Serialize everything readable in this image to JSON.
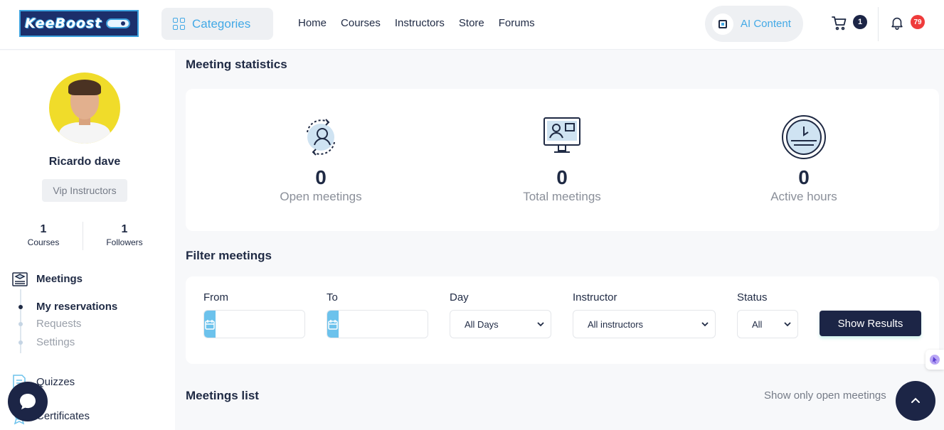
{
  "header": {
    "logo_text": "KeeBoost",
    "categories_label": "Categories",
    "nav": [
      "Home",
      "Courses",
      "Instructors",
      "Store",
      "Forums"
    ],
    "ai_label": "AI Content",
    "cart_count": "1",
    "notif_count": "79"
  },
  "sidebar": {
    "user_name": "Ricardo dave",
    "role": "Vip Instructors",
    "stats": [
      {
        "value": "1",
        "label": "Courses"
      },
      {
        "value": "1",
        "label": "Followers"
      }
    ],
    "menu_title": "Meetings",
    "submenu": [
      "My reservations",
      "Requests",
      "Settings"
    ],
    "items": [
      "Quizzes",
      "Certificates"
    ]
  },
  "main": {
    "stats_title": "Meeting statistics",
    "stats": [
      {
        "value": "0",
        "label": "Open meetings",
        "icon": "open-meetings-icon"
      },
      {
        "value": "0",
        "label": "Total meetings",
        "icon": "total-meetings-icon"
      },
      {
        "value": "0",
        "label": "Active hours",
        "icon": "active-hours-icon"
      }
    ],
    "filter_title": "Filter meetings",
    "filter": {
      "from_label": "From",
      "to_label": "To",
      "day_label": "Day",
      "day_value": "All Days",
      "instructor_label": "Instructor",
      "instructor_value": "All instructors",
      "status_label": "Status",
      "status_value": "All",
      "submit_label": "Show Results"
    },
    "list_title": "Meetings list",
    "open_only_label": "Show only open meetings"
  },
  "colors": {
    "primary_dark": "#1c2546",
    "accent_blue": "#43a9e6",
    "calendar_blue": "#6cc2ec",
    "badge_red": "#ef3b3b"
  }
}
